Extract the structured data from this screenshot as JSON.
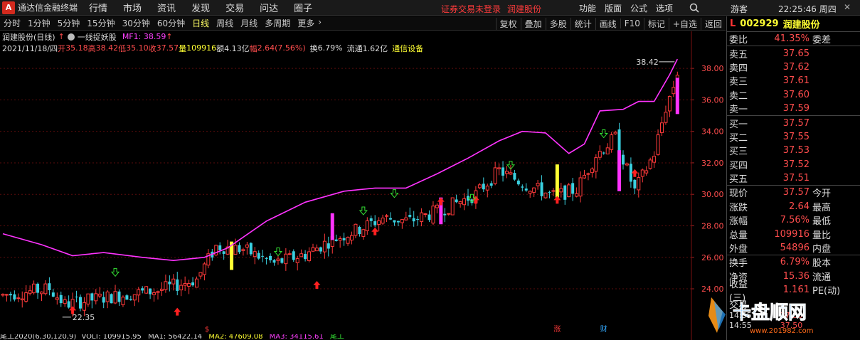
{
  "app": {
    "logo": "A",
    "title": "通达信金融终端"
  },
  "menu_left": [
    "行情",
    "市场",
    "资讯",
    "发现",
    "交易",
    "问达",
    "圈子"
  ],
  "status": {
    "login": "证券交易未登录",
    "stock": "润建股份"
  },
  "menu_right": [
    "功能",
    "版面",
    "公式",
    "选项"
  ],
  "user": "游客",
  "clock": "22:25:46 周四",
  "periods": [
    {
      "label": "分时",
      "active": false
    },
    {
      "label": "1分钟",
      "active": false
    },
    {
      "label": "5分钟",
      "active": false
    },
    {
      "label": "15分钟",
      "active": false
    },
    {
      "label": "30分钟",
      "active": false
    },
    {
      "label": "60分钟",
      "active": false
    },
    {
      "label": "日线",
      "active": true
    },
    {
      "label": "周线",
      "active": false
    },
    {
      "label": "月线",
      "active": false
    },
    {
      "label": "多周期",
      "active": false
    },
    {
      "label": "更多",
      "active": false
    }
  ],
  "toolbar_right": [
    "复权",
    "叠加",
    "多股",
    "统计",
    "画线",
    "F10",
    "标记",
    "+自选",
    "返回"
  ],
  "chart_head": {
    "title": "润建股份(日线)",
    "indicator": "一线捉妖股",
    "mf_label": "MF1: 38.59"
  },
  "ohlc": {
    "date": "2021/11/18/四",
    "open_label": "开",
    "open": "35.18",
    "high_label": "高",
    "high": "38.42",
    "low_label": "低",
    "low": "35.10",
    "close_label": "收",
    "close": "37.57",
    "vol_label": "量",
    "vol": "109916",
    "amt_label": "额",
    "amt": "4.13亿",
    "chg_label": "幅",
    "chg": "2.64(7.56%)",
    "turn_label": "换",
    "turn": "6.79%",
    "float_label": "流通",
    "float": "1.62亿",
    "sector": "通信设备"
  },
  "chart_data": {
    "type": "candlestick",
    "y_axis": {
      "ticks": [
        24.0,
        26.0,
        28.0,
        30.0,
        32.0,
        34.0,
        36.0,
        38.0
      ],
      "range": [
        21.2,
        39.0
      ]
    },
    "annotations": {
      "high": "38.42",
      "low": "22.35"
    },
    "bottom_markers": [
      "$",
      "涨",
      "财"
    ]
  },
  "panel": {
    "l_mark": "L",
    "code": "002929",
    "name": "润建股份",
    "ratio": {
      "label": "委比",
      "value": "41.35%",
      "right": "委差"
    },
    "asks": [
      {
        "label": "卖五",
        "price": "37.65"
      },
      {
        "label": "卖四",
        "price": "37.62"
      },
      {
        "label": "卖三",
        "price": "37.61"
      },
      {
        "label": "卖二",
        "price": "37.60"
      },
      {
        "label": "卖一",
        "price": "37.59"
      }
    ],
    "bids": [
      {
        "label": "买一",
        "price": "37.57"
      },
      {
        "label": "买二",
        "price": "37.55"
      },
      {
        "label": "买三",
        "price": "37.53"
      },
      {
        "label": "买四",
        "price": "37.52"
      },
      {
        "label": "买五",
        "price": "37.51"
      }
    ],
    "stats": [
      {
        "label": "现价",
        "value": "37.57",
        "right": "今开"
      },
      {
        "label": "涨跌",
        "value": "2.64",
        "right": "最高"
      },
      {
        "label": "涨幅",
        "value": "7.56%",
        "right": "最低"
      },
      {
        "label": "总量",
        "value": "109916",
        "right": "量比"
      },
      {
        "label": "外盘",
        "value": "54896",
        "right": "内盘"
      }
    ],
    "stats2": [
      {
        "label": "换手",
        "value": "6.79%",
        "right": "股本"
      },
      {
        "label": "净资",
        "value": "15.36",
        "right": "流通"
      },
      {
        "label": "收益(三)",
        "value": "1.161",
        "right": "PE(动)"
      },
      {
        "label": "交易",
        "value": "",
        "right": ""
      }
    ],
    "ticks": [
      {
        "time": "14:55",
        "price": "37.50"
      },
      {
        "time": "14:55",
        "price": "37.50"
      }
    ]
  },
  "bottom_bar": {
    "label": "尾工2020(6,30,120,9)",
    "volt": "VOLT: 109915.95",
    "ma1": "MA1: 56422.14",
    "ma2": "MA2: 47609.08",
    "ma3": "MA3: 34115.61",
    "extra": "尾工"
  },
  "watermark": {
    "text": "卡盘顺网",
    "url": "www.201982.com"
  }
}
